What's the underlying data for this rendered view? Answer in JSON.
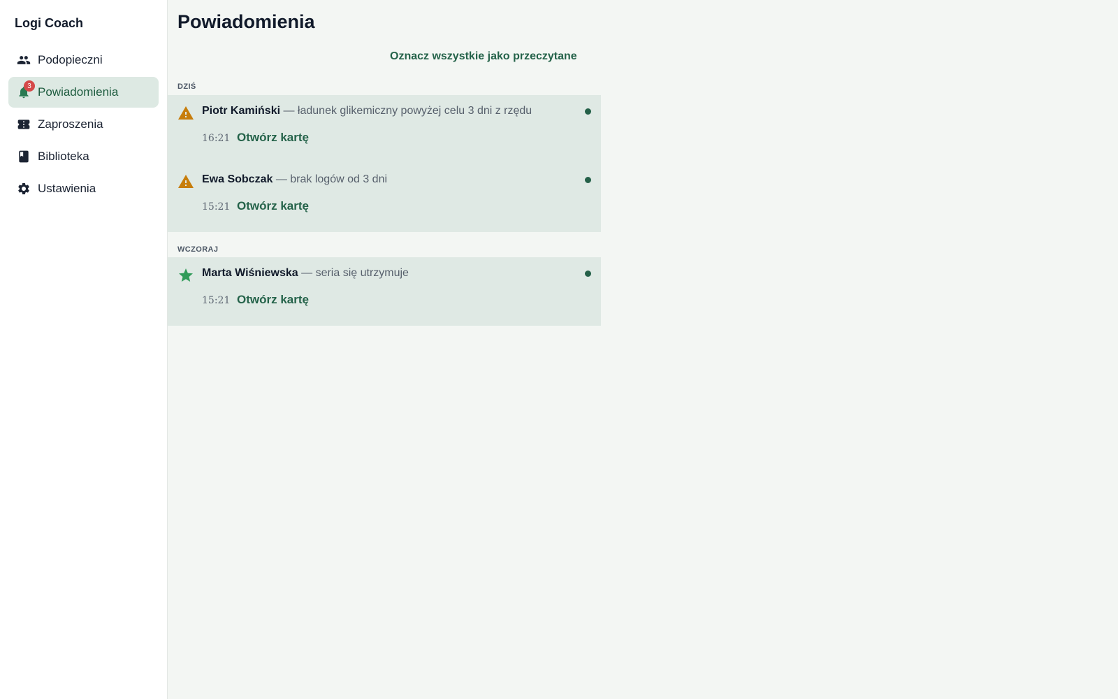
{
  "app": {
    "brand": "Logi Coach"
  },
  "sidebar": {
    "items": [
      {
        "label": "Podopieczni",
        "icon": "users-icon"
      },
      {
        "label": "Powiadomienia",
        "icon": "bell-icon",
        "badge": "3",
        "active": true
      },
      {
        "label": "Zaproszenia",
        "icon": "ticket-icon"
      },
      {
        "label": "Biblioteka",
        "icon": "book-icon"
      },
      {
        "label": "Ustawienia",
        "icon": "gear-icon"
      }
    ]
  },
  "main": {
    "title": "Powiadomienia",
    "mark_all_label": "Oznacz wszystkie jako przeczytane",
    "sections": [
      {
        "label": "DZIŚ",
        "notifications": [
          {
            "icon": "warning-icon",
            "name": "Piotr Kamiński",
            "message": " — ładunek glikemiczny powyżej celu 3 dni z rzędu",
            "time": "16:21",
            "link": "Otwórz kartę",
            "unread": true
          },
          {
            "icon": "warning-icon",
            "name": "Ewa Sobczak",
            "message": " — brak logów od 3 dni",
            "time": "15:21",
            "link": "Otwórz kartę",
            "unread": true
          }
        ]
      },
      {
        "label": "WCZORAJ",
        "notifications": [
          {
            "icon": "star-icon",
            "name": "Marta Wiśniewska",
            "message": " — seria się utrzymuje",
            "time": "15:21",
            "link": "Otwórz kartę",
            "unread": true
          }
        ]
      }
    ]
  },
  "colors": {
    "accent": "#25634a",
    "warning": "#c77d0b",
    "star": "#2f9b58",
    "badge": "#d54a4a",
    "unread_bg": "#dfe9e4"
  }
}
